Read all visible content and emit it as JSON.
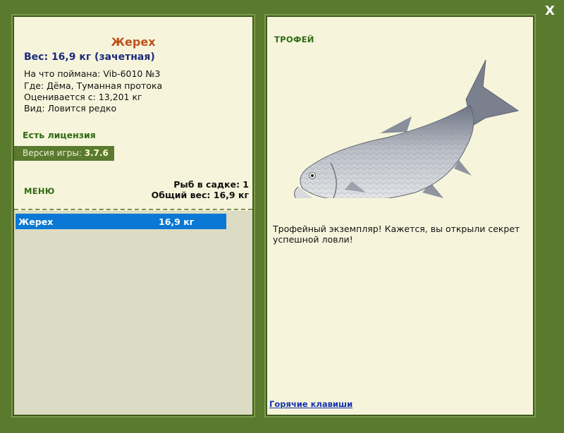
{
  "window": {
    "close_label": "X"
  },
  "catch": {
    "fish_name": "Жерех",
    "weight_line": "Вес: 16,9 кг (зачетная)",
    "details": [
      "На что поймана: Vib-6010 №3",
      "Где: Дёма, Туманная протока",
      "Оценивается с: 13,201 кг",
      "Вид: Ловится редко"
    ]
  },
  "license": "Есть лицензия",
  "version": {
    "label": "Версия игры:",
    "number": "3.7.6"
  },
  "menu_label": "МЕНЮ",
  "stats": {
    "fish_count": "Рыб в садке: 1",
    "total_weight": "Общий вес: 16,9 кг"
  },
  "cage_list": [
    {
      "name": "Жерех",
      "weight": "16,9 кг"
    }
  ],
  "trophy": {
    "label": "ТРОФЕЙ",
    "description": "Трофейный экземпляр! Кажется, вы открыли секрет успешной ловли!"
  },
  "hotkeys_link": "Горячие клавиши",
  "colors": {
    "frame": "#5a7a2e",
    "panel_bg": "#f6f5dc",
    "title_orange": "#c0501a",
    "weight_navy": "#1c2a7a",
    "green_text": "#2f6a13",
    "selection_blue": "#0a78d4",
    "link_blue": "#1533b0"
  },
  "icons": {
    "close": "close-icon",
    "fish": "asp-fish-image"
  }
}
